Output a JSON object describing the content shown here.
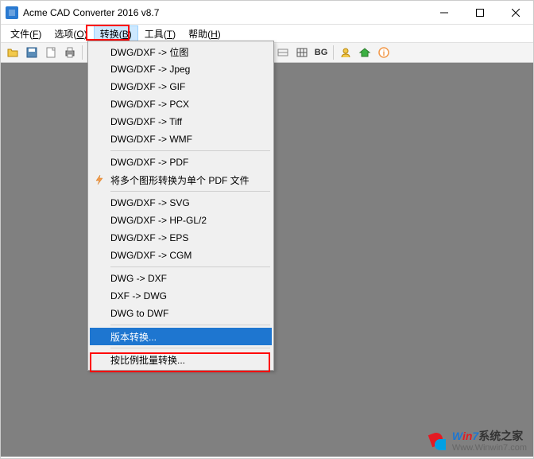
{
  "window": {
    "title": "Acme CAD Converter 2016 v8.7"
  },
  "menubar": {
    "file": {
      "label": "文件",
      "hotkey": "F"
    },
    "options": {
      "label": "选项",
      "hotkey": "O"
    },
    "convert": {
      "label": "转换",
      "hotkey": "B"
    },
    "tools": {
      "label": "工具",
      "hotkey": "T"
    },
    "help": {
      "label": "帮助",
      "hotkey": "H"
    }
  },
  "toolbar": {
    "bg_label": "BG"
  },
  "dropdown": {
    "items": [
      {
        "label": "DWG/DXF -> 位图"
      },
      {
        "label": "DWG/DXF -> Jpeg"
      },
      {
        "label": "DWG/DXF -> GIF"
      },
      {
        "label": "DWG/DXF -> PCX"
      },
      {
        "label": "DWG/DXF -> Tiff"
      },
      {
        "label": "DWG/DXF -> WMF"
      }
    ],
    "group2": [
      {
        "label": "DWG/DXF -> PDF"
      },
      {
        "label": "将多个图形转换为单个 PDF 文件",
        "icon": true
      }
    ],
    "group3": [
      {
        "label": "DWG/DXF -> SVG"
      },
      {
        "label": "DWG/DXF -> HP-GL/2"
      },
      {
        "label": "DWG/DXF -> EPS"
      },
      {
        "label": "DWG/DXF -> CGM"
      }
    ],
    "group4": [
      {
        "label": "DWG -> DXF"
      },
      {
        "label": "DXF -> DWG"
      },
      {
        "label": "DWG to DWF"
      }
    ],
    "group5": [
      {
        "label": "版本转换...",
        "selected": true
      }
    ],
    "group6": [
      {
        "label": "按比例批量转换..."
      }
    ]
  },
  "watermark": {
    "brand_prefix": "W",
    "brand_mid": "in",
    "brand_digit": "7",
    "brand_suffix": "系统之家",
    "url": "Www.Winwin7.com"
  }
}
